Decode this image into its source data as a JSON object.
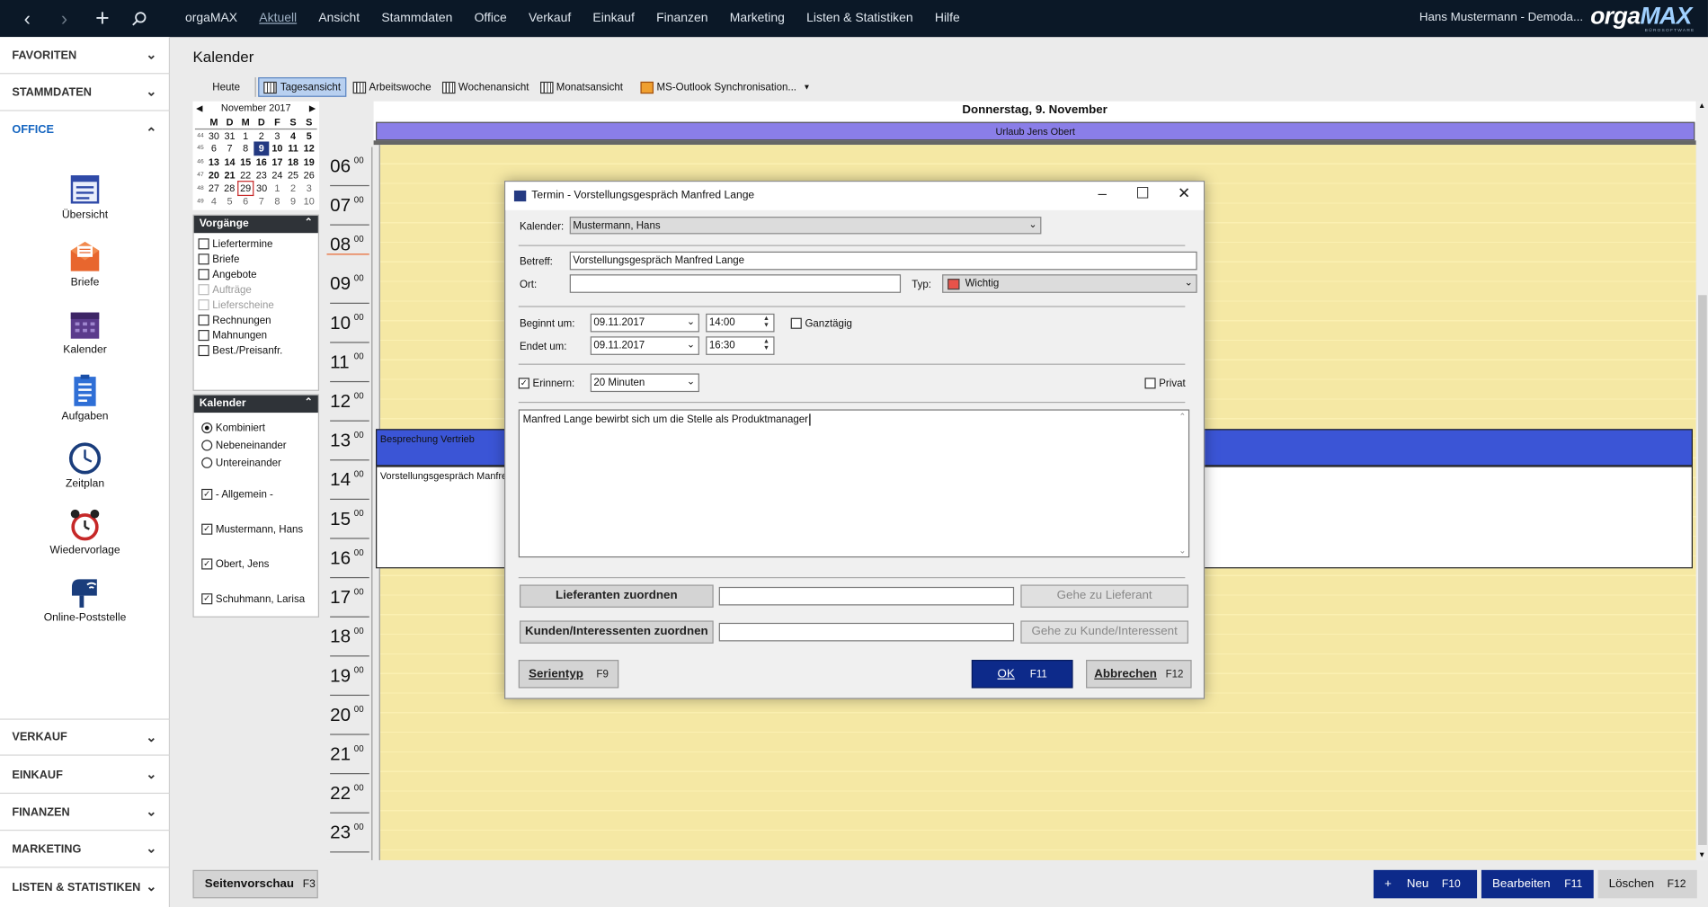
{
  "topbar": {
    "nav": {
      "back": "back-arrow",
      "forward": "forward-arrow",
      "add": "plus-icon",
      "search": "search-icon"
    },
    "menu": [
      "orgaMAX",
      "Aktuell",
      "Ansicht",
      "Stammdaten",
      "Office",
      "Verkauf",
      "Einkauf",
      "Finanzen",
      "Marketing",
      "Listen & Statistiken",
      "Hilfe"
    ],
    "user": "Hans Mustermann - Demoda...",
    "logo_a": "orga",
    "logo_b": "MAX",
    "logo_sub": "BÜROSOFTWARE"
  },
  "sidebar": {
    "favoriten": "FAVORITEN",
    "stammdaten": "STAMMDATEN",
    "office": "OFFICE",
    "icons": [
      "Übersicht",
      "Briefe",
      "Kalender",
      "Aufgaben",
      "Zeitplan",
      "Wiedervorlage",
      "Online-Poststelle"
    ],
    "verkauf": "VERKAUF",
    "einkauf": "EINKAUF",
    "finanzen": "FINANZEN",
    "marketing": "MARKETING",
    "listen": "LISTEN & STATISTIKEN"
  },
  "main": {
    "title": "Kalender",
    "toolbar": [
      "Heute",
      "Tagesansicht",
      "Arbeitswoche",
      "Wochenansicht",
      "Monatsansicht",
      "MS-Outlook Synchronisation..."
    ]
  },
  "minical": {
    "month": "November 2017",
    "days": [
      "M",
      "D",
      "M",
      "D",
      "F",
      "S",
      "S"
    ],
    "weeks": [
      {
        "wk": "44",
        "d": [
          "30",
          "31",
          "1",
          "2",
          "3",
          "4",
          "5"
        ]
      },
      {
        "wk": "45",
        "d": [
          "6",
          "7",
          "8",
          "9",
          "10",
          "11",
          "12"
        ]
      },
      {
        "wk": "46",
        "d": [
          "13",
          "14",
          "15",
          "16",
          "17",
          "18",
          "19"
        ]
      },
      {
        "wk": "47",
        "d": [
          "20",
          "21",
          "22",
          "23",
          "24",
          "25",
          "26"
        ]
      },
      {
        "wk": "48",
        "d": [
          "27",
          "28",
          "29",
          "30",
          "1",
          "2",
          "3"
        ]
      },
      {
        "wk": "49",
        "d": [
          "4",
          "5",
          "6",
          "7",
          "8",
          "9",
          "10"
        ]
      }
    ]
  },
  "vorgaenge": {
    "title": "Vorgänge",
    "items": [
      "Liefertermine",
      "Briefe",
      "Angebote",
      "Aufträge",
      "Lieferscheine",
      "Rechnungen",
      "Mahnungen",
      "Best./Preisanfr."
    ]
  },
  "kalender_panel": {
    "title": "Kalender",
    "modes": [
      "Kombiniert",
      "Nebeneinander",
      "Untereinander"
    ],
    "calendars": [
      "- Allgemein -",
      "Mustermann, Hans",
      "Obert, Jens",
      "Schuhmann, Larisa"
    ]
  },
  "day": {
    "header": "Donnerstag, 9. November",
    "allday": "Urlaub Jens Obert",
    "hours": [
      "06",
      "07",
      "08",
      "09",
      "10",
      "11",
      "12",
      "13",
      "14",
      "15",
      "16",
      "17",
      "18",
      "19",
      "20",
      "21",
      "22",
      "23"
    ],
    "minutes": "00",
    "events": [
      "Besprechung Vertrieb",
      "Vorstellungsgespräch Manfred Lange"
    ]
  },
  "dialog": {
    "title": "Termin - Vorstellungsgespräch Manfred Lange",
    "kalender_label": "Kalender:",
    "kalender_value": "Mustermann, Hans",
    "betreff_label": "Betreff:",
    "betreff_value": "Vorstellungsgespräch Manfred Lange",
    "ort_label": "Ort:",
    "ort_value": "",
    "typ_label": "Typ:",
    "typ_value": "Wichtig",
    "typ_color": "#e8534a",
    "beginn_label": "Beginnt um:",
    "beginn_date": "09.11.2017",
    "beginn_time": "14:00",
    "ende_label": "Endet um:",
    "ende_date": "09.11.2017",
    "ende_time": "16:30",
    "ganztaegig": "Ganztägig",
    "erinnern": "Erinnern:",
    "erinnern_value": "20 Minuten",
    "privat": "Privat",
    "notes": "Manfred Lange bewirbt sich um die Stelle als Produktmanager",
    "lieferanten_btn": "Lieferanten zuordnen",
    "lieferant_goto": "Gehe zu Lieferant",
    "kunden_btn": "Kunden/Interessenten zuordnen",
    "kunde_goto": "Gehe zu Kunde/Interessent",
    "serientyp": "Serientyp",
    "serientyp_key": "F9",
    "ok": "OK",
    "ok_key": "F11",
    "abbrechen": "Abbrechen",
    "abbrechen_key": "F12"
  },
  "bottom": {
    "seitenvorschau": "Seitenvorschau",
    "seitenvorschau_key": "F3",
    "neu": "Neu",
    "neu_key": "F10",
    "bearbeiten": "Bearbeiten",
    "bearbeiten_key": "F11",
    "loeschen": "Löschen",
    "loeschen_key": "F12"
  },
  "colors": {
    "topbar": "#0b1827",
    "accent": "#1565c0",
    "ok_button": "#0d2a8a",
    "allday": "#8a7ee8",
    "event_blue": "#3b55d6",
    "day_bg": "#f5e8a4"
  }
}
